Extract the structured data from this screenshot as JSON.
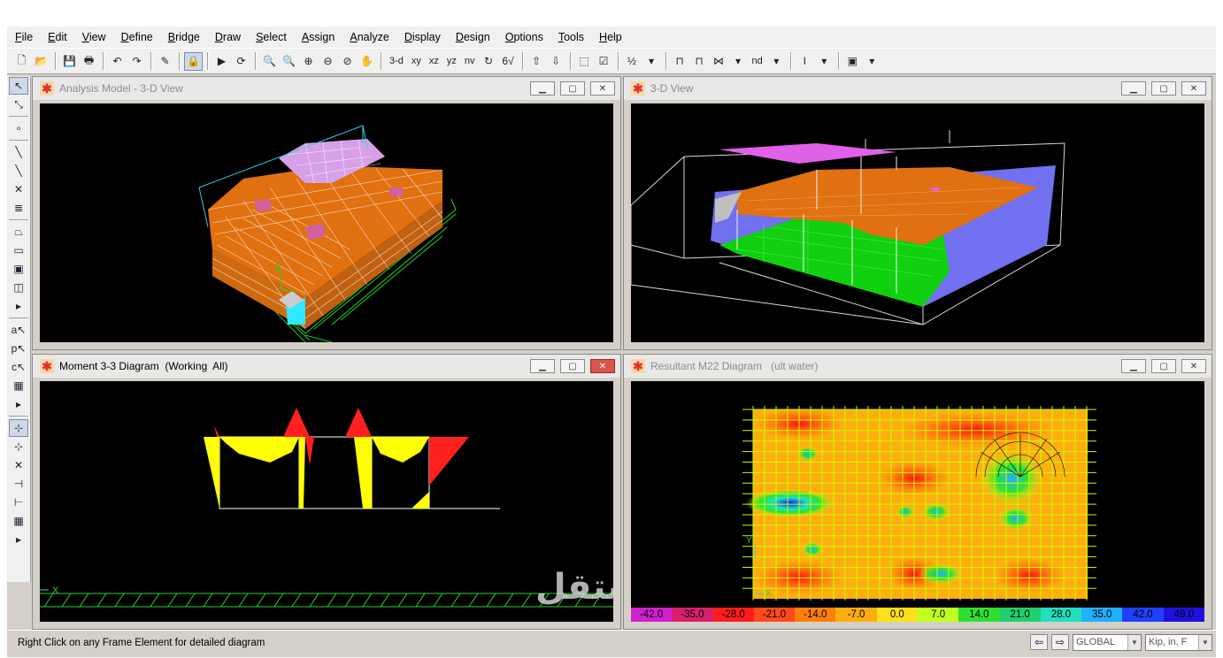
{
  "menu": [
    {
      "label": "File",
      "u": "F",
      "rest": "ile"
    },
    {
      "label": "Edit",
      "u": "E",
      "rest": "dit"
    },
    {
      "label": "View",
      "u": "V",
      "rest": "iew"
    },
    {
      "label": "Define",
      "u": "D",
      "rest": "efine"
    },
    {
      "label": "Bridge",
      "u": "B",
      "rest": "ridge"
    },
    {
      "label": "Draw",
      "u": "D",
      "rest": "raw"
    },
    {
      "label": "Select",
      "u": "S",
      "rest": "elect"
    },
    {
      "label": "Assign",
      "u": "A",
      "rest": "ssign"
    },
    {
      "label": "Analyze",
      "u": "A",
      "rest": "nalyze"
    },
    {
      "label": "Display",
      "u": "D",
      "rest": "isplay"
    },
    {
      "label": "Design",
      "u": "D",
      "rest": "esign"
    },
    {
      "label": "Options",
      "u": "O",
      "rest": "ptions"
    },
    {
      "label": "Tools",
      "u": "T",
      "rest": "ools"
    },
    {
      "label": "Help",
      "u": "H",
      "rest": "elp"
    }
  ],
  "toolbar": {
    "view_3d": "3-d",
    "view_xy": "xy",
    "view_xz": "xz",
    "view_yz": "yz",
    "view_nv": "nv",
    "view_nd": "nd"
  },
  "windows": {
    "analysis_model": {
      "title": "Analysis Model - 3-D View"
    },
    "view_3d": {
      "title": "3-D View"
    },
    "moment": {
      "title": "Moment 3-3 Diagram  (Working  All)"
    },
    "resultant": {
      "title": "Resultant M22 Diagram   (ult water)"
    }
  },
  "axis_labels": {
    "z": "Z",
    "x": "X",
    "y": "Y"
  },
  "legend": {
    "values": [
      "-42.0",
      "-35.0",
      "-28.0",
      "-21.0",
      "-14.0",
      "-7.0",
      "0.0",
      "7.0",
      "14.0",
      "21.0",
      "28.0",
      "35.0",
      "42.0",
      "49.0"
    ],
    "colors": [
      "#d020d0",
      "#d8206a",
      "#ff1e1e",
      "#ff4a1a",
      "#ff7f0a",
      "#ffae10",
      "#ffe01a",
      "#c0ff20",
      "#30e030",
      "#20d070",
      "#20e0c0",
      "#20b0ff",
      "#2040ff",
      "#2010e0"
    ]
  },
  "status": {
    "message": "Right Click on any Frame Element for detailed diagram",
    "coord_system": "GLOBAL",
    "units": "Kip, in, F"
  },
  "watermark": "مستقل"
}
